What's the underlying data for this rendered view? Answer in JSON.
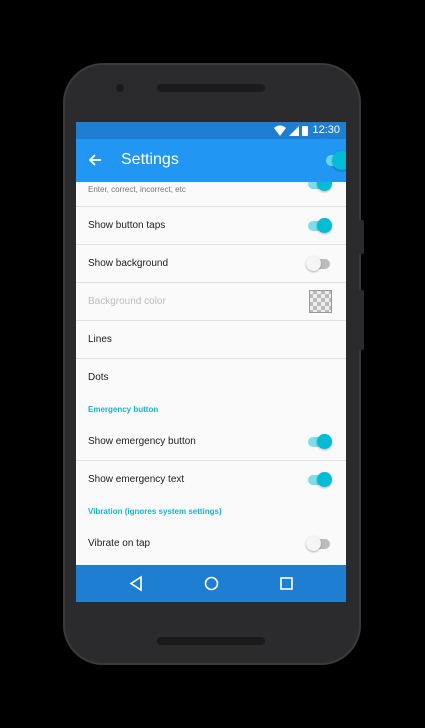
{
  "status_bar": {
    "time": "12:30"
  },
  "app_bar": {
    "title": "Settings",
    "master_switch_on": true
  },
  "settings": {
    "partial_item": {
      "label": "Enter, correct, incorrect, etc",
      "switch_on": true
    },
    "items": [
      {
        "label": "Show button taps",
        "switch_on": true
      },
      {
        "label": "Show background",
        "switch_on": false
      },
      {
        "label": "Background color",
        "disabled": true
      },
      {
        "label": "Lines"
      },
      {
        "label": "Dots"
      }
    ],
    "emergency_section": {
      "header": "Emergency button",
      "items": [
        {
          "label": "Show emergency button",
          "switch_on": true
        },
        {
          "label": "Show emergency text",
          "switch_on": true
        }
      ]
    },
    "vibration_section": {
      "header": "Vibration (ignores system settings)",
      "items": [
        {
          "label": "Vibrate on tap",
          "switch_on": false
        }
      ]
    }
  },
  "colors": {
    "status_bar": "#1e7fd2",
    "app_bar": "#2196f3",
    "accent": "#00bcd4",
    "section_header": "#19b3cf"
  },
  "icons": [
    "back-arrow-icon",
    "wifi-icon",
    "signal-icon",
    "battery-icon",
    "nav-back-icon",
    "nav-home-icon",
    "nav-recents-icon"
  ]
}
